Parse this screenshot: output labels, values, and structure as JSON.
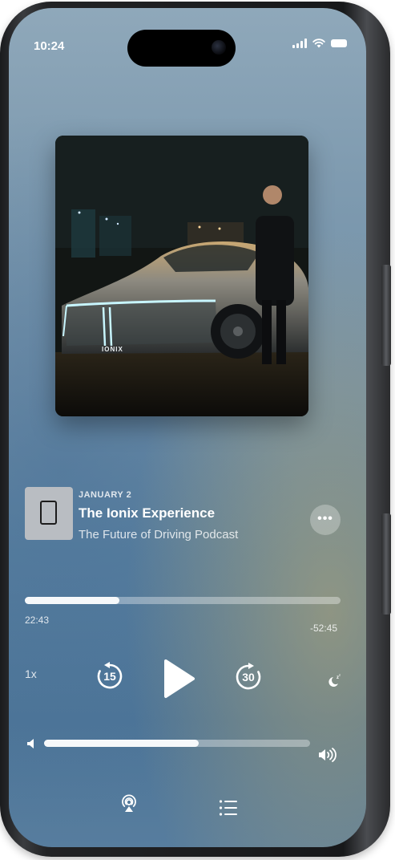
{
  "status_bar": {
    "time": "10:24",
    "icons": [
      "signal-icon",
      "wifi-icon",
      "battery-icon"
    ]
  },
  "now_playing": {
    "artwork_badge": "IONIX",
    "episode": {
      "date": "JANUARY 2",
      "title": "The Ionix Experience",
      "show": "The Future of Driving Podcast"
    },
    "more_icon": "ellipsis-icon",
    "playback": {
      "elapsed": "22:43",
      "remaining": "-52:45",
      "progress_fraction": 0.3
    },
    "controls": {
      "speed_label": "1x",
      "skip_back_label": "15",
      "skip_forward_label": "30",
      "play_icon": "play-icon",
      "sleep_icon": "sleep-timer-icon"
    },
    "volume": {
      "level_fraction": 0.58,
      "low_icon": "speaker-low-icon",
      "high_icon": "speaker-high-icon"
    },
    "bottom_bar": {
      "icons": [
        "airplay-icon",
        "queue-list-icon"
      ]
    }
  },
  "colors": {
    "background_top": "#8fa8ba",
    "background_bottom": "#4d7598",
    "accent_warm": "#bea96e",
    "text_primary": "#ffffff"
  }
}
